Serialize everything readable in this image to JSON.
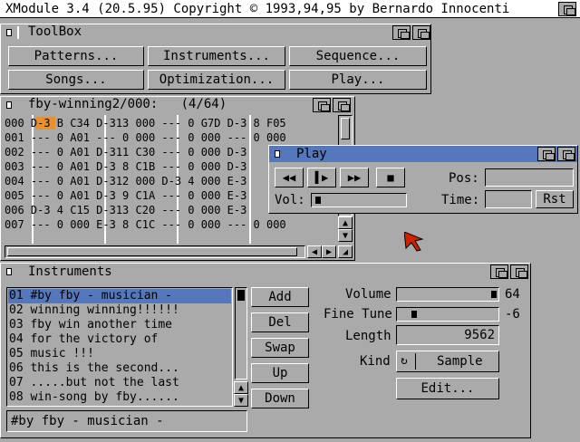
{
  "screen": {
    "title": "XModule 3.4 (20.5.95) Copyright © 1993,94,95 by Bernardo Innocenti",
    "front_gadget": "front-back-gadget"
  },
  "toolbox": {
    "title": "ToolBox",
    "buttons": [
      "Patterns...",
      "Instruments...",
      "Sequence...",
      "Songs...",
      "Optimization...",
      "Play..."
    ]
  },
  "pattern": {
    "title": "fby-winning2/000:   (4/64)",
    "rows": [
      "000 D-3 B C34 D-313 000 --- 0 G7D D-3 8 F05",
      "001 --- 0 A01 --- 0 000 --- 0 000 --- 0 000",
      "002 --- 0 A01 D-311 C30 --- 0 000 D-3",
      "003 --- 0 A01 D-3 8 C1B --- 0 000 D-3",
      "004 --- 0 A01 D-312 000 D-3 4 000 E-3",
      "005 --- 0 A01 D-3 9 C1A --- 0 000 E-3",
      "006 D-3 4 C15 D-313 C20 --- 0 000 E-3",
      "007 --- 0 000 E-3 8 C1C --- 0 000 --- 0 000"
    ]
  },
  "play": {
    "title": "Play",
    "pos_label": "Pos:",
    "time_label": "Time:",
    "vol_label": "Vol:",
    "rst_label": "Rst",
    "pos_value": "",
    "time_value": "",
    "volume_level": 0.05
  },
  "instruments": {
    "title": "Instruments",
    "list": [
      "01 #by fby - musician -",
      "02 winning winning!!!!!!",
      "03 fby win another time",
      "04 for the victory of",
      "05 music !!!",
      "06 this is the second...",
      "07 .....but not the last",
      "08 win-song by fby......"
    ],
    "selected_index": 0,
    "name_field": "#by fby - musician -",
    "buttons": [
      "Add",
      "Del",
      "Swap",
      "Up",
      "Down"
    ],
    "volume_label": "Volume",
    "volume_value": "64",
    "volume_fraction": 1.0,
    "finetune_label": "Fine Tune",
    "finetune_value": "-6",
    "finetune_fraction": 0.1,
    "length_label": "Length",
    "length_value": "9562",
    "kind_label": "Kind",
    "kind_value": "Sample",
    "edit_label": "Edit..."
  },
  "colors": {
    "background": "#aaaaaa",
    "highlight": "#5577bb",
    "cursor": "#ff8800",
    "pointer": "#cc2200"
  }
}
